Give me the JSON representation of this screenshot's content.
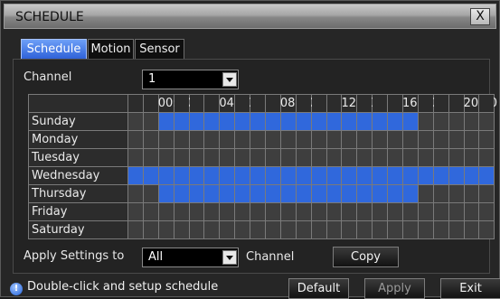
{
  "window": {
    "title": "SCHEDULE",
    "close_glyph": "X"
  },
  "tabs": [
    {
      "label": "Schedule",
      "active": true
    },
    {
      "label": "Motion",
      "active": false
    },
    {
      "label": "Sensor",
      "active": false
    }
  ],
  "channel": {
    "label": "Channel",
    "value": "1"
  },
  "schedule": {
    "hour_labels": [
      "00:00",
      "04:00",
      "08:00",
      "12:00",
      "16:00",
      "20:00"
    ],
    "days": [
      {
        "name": "Sunday",
        "active_hours": [
          2,
          3,
          4,
          5,
          6,
          7,
          8,
          9,
          10,
          11,
          12,
          13,
          14,
          15,
          16,
          17,
          18
        ]
      },
      {
        "name": "Monday",
        "active_hours": []
      },
      {
        "name": "Tuesday",
        "active_hours": []
      },
      {
        "name": "Wednesday",
        "active_hours": [
          0,
          1,
          2,
          3,
          4,
          5,
          6,
          7,
          8,
          9,
          10,
          11,
          12,
          13,
          14,
          15,
          16,
          17,
          18,
          19,
          20,
          21,
          22,
          23
        ]
      },
      {
        "name": "Thursday",
        "active_hours": [
          2,
          3,
          4,
          5,
          6,
          7,
          8,
          9,
          10,
          11,
          12,
          13,
          14,
          15,
          16,
          17,
          18
        ]
      },
      {
        "name": "Friday",
        "active_hours": []
      },
      {
        "name": "Saturday",
        "active_hours": []
      }
    ],
    "active_color": "#3068dc",
    "inactive_color": "#3e3e3e"
  },
  "apply": {
    "label": "Apply Settings to",
    "value": "All",
    "suffix": "Channel",
    "copy_label": "Copy"
  },
  "footer": {
    "hint": "Double-click and setup schedule",
    "default_label": "Default",
    "apply_label": "Apply",
    "exit_label": "Exit"
  }
}
